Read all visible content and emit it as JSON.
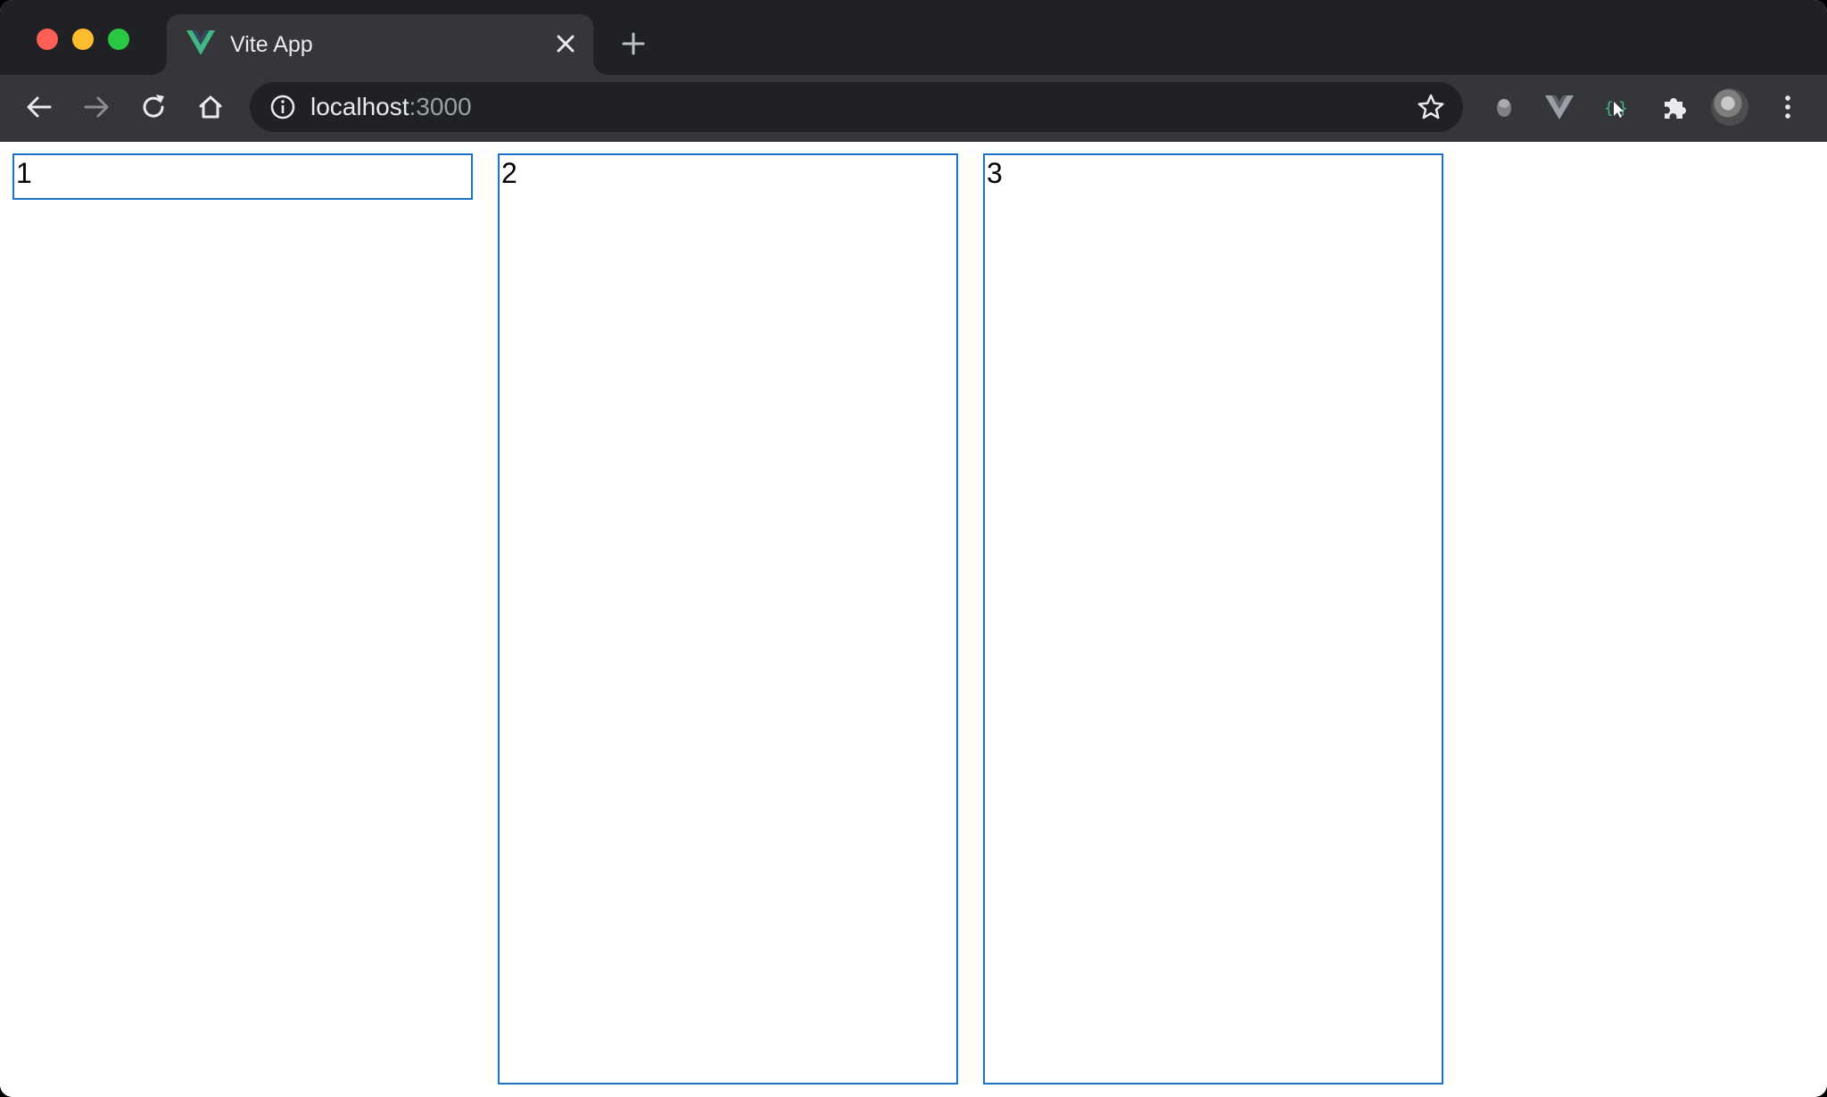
{
  "browser": {
    "tab": {
      "title": "Vite App",
      "favicon": "vue-logo-icon"
    },
    "address_bar": {
      "host": "localhost",
      "port": ":3000"
    },
    "extensions": [
      "ghost-extension-icon",
      "vue-devtools-icon",
      "json-picker-icon",
      "puzzle-icon"
    ],
    "colors": {
      "tabstrip": "#202124",
      "toolbar": "#35363a",
      "accent_vue": "#41b883"
    }
  },
  "page": {
    "boxes": [
      {
        "label": "1"
      },
      {
        "label": "2"
      },
      {
        "label": "3"
      }
    ],
    "border_color": "#1f6fc5"
  }
}
